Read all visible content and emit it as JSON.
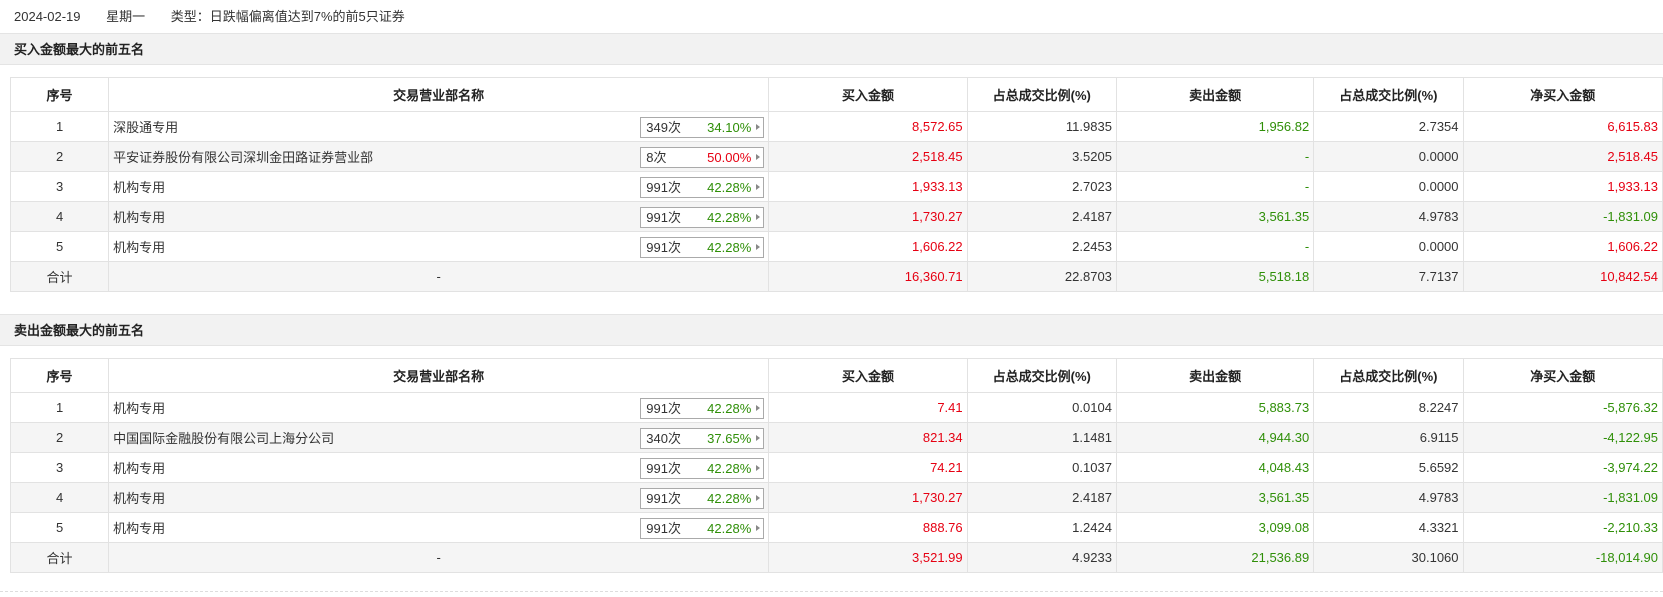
{
  "header": {
    "date": "2024-02-19",
    "weekday": "星期一",
    "type_text": "类型：日跌幅偏离值达到7%的前5只证券"
  },
  "buy_section": {
    "title": "买入金额最大的前五名",
    "columns": [
      "序号",
      "交易营业部名称",
      "买入金额",
      "占总成交比例(%)",
      "卖出金额",
      "占总成交比例(%)",
      "净买入金额"
    ],
    "rows": [
      {
        "idx": "1",
        "name": "深股通专用",
        "count": "349次",
        "rate": "34.10%",
        "rate_color": "green",
        "buy": "8,572.65",
        "buy_pct": "11.9835",
        "sell": "1,956.82",
        "sell_pct": "2.7354",
        "net": "6,615.83",
        "net_color": "red"
      },
      {
        "idx": "2",
        "name": "平安证券股份有限公司深圳金田路证券营业部",
        "count": "8次",
        "rate": "50.00%",
        "rate_color": "red",
        "buy": "2,518.45",
        "buy_pct": "3.5205",
        "sell": "-",
        "sell_pct": "0.0000",
        "net": "2,518.45",
        "net_color": "red"
      },
      {
        "idx": "3",
        "name": "机构专用",
        "count": "991次",
        "rate": "42.28%",
        "rate_color": "green",
        "buy": "1,933.13",
        "buy_pct": "2.7023",
        "sell": "-",
        "sell_pct": "0.0000",
        "net": "1,933.13",
        "net_color": "red"
      },
      {
        "idx": "4",
        "name": "机构专用",
        "count": "991次",
        "rate": "42.28%",
        "rate_color": "green",
        "buy": "1,730.27",
        "buy_pct": "2.4187",
        "sell": "3,561.35",
        "sell_pct": "4.9783",
        "net": "-1,831.09",
        "net_color": "green"
      },
      {
        "idx": "5",
        "name": "机构专用",
        "count": "991次",
        "rate": "42.28%",
        "rate_color": "green",
        "buy": "1,606.22",
        "buy_pct": "2.2453",
        "sell": "-",
        "sell_pct": "0.0000",
        "net": "1,606.22",
        "net_color": "red"
      }
    ],
    "total": {
      "label": "合计",
      "name": "-",
      "buy": "16,360.71",
      "buy_pct": "22.8703",
      "sell": "5,518.18",
      "sell_pct": "7.7137",
      "net": "10,842.54",
      "net_color": "red"
    }
  },
  "sell_section": {
    "title": "卖出金额最大的前五名",
    "columns": [
      "序号",
      "交易营业部名称",
      "买入金额",
      "占总成交比例(%)",
      "卖出金额",
      "占总成交比例(%)",
      "净买入金额"
    ],
    "rows": [
      {
        "idx": "1",
        "name": "机构专用",
        "count": "991次",
        "rate": "42.28%",
        "rate_color": "green",
        "buy": "7.41",
        "buy_pct": "0.0104",
        "sell": "5,883.73",
        "sell_pct": "8.2247",
        "net": "-5,876.32",
        "net_color": "green"
      },
      {
        "idx": "2",
        "name": "中国国际金融股份有限公司上海分公司",
        "count": "340次",
        "rate": "37.65%",
        "rate_color": "green",
        "buy": "821.34",
        "buy_pct": "1.1481",
        "sell": "4,944.30",
        "sell_pct": "6.9115",
        "net": "-4,122.95",
        "net_color": "green"
      },
      {
        "idx": "3",
        "name": "机构专用",
        "count": "991次",
        "rate": "42.28%",
        "rate_color": "green",
        "buy": "74.21",
        "buy_pct": "0.1037",
        "sell": "4,048.43",
        "sell_pct": "5.6592",
        "net": "-3,974.22",
        "net_color": "green"
      },
      {
        "idx": "4",
        "name": "机构专用",
        "count": "991次",
        "rate": "42.28%",
        "rate_color": "green",
        "buy": "1,730.27",
        "buy_pct": "2.4187",
        "sell": "3,561.35",
        "sell_pct": "4.9783",
        "net": "-1,831.09",
        "net_color": "green"
      },
      {
        "idx": "5",
        "name": "机构专用",
        "count": "991次",
        "rate": "42.28%",
        "rate_color": "green",
        "buy": "888.76",
        "buy_pct": "1.2424",
        "sell": "3,099.08",
        "sell_pct": "4.3321",
        "net": "-2,210.33",
        "net_color": "green"
      }
    ],
    "total": {
      "label": "合计",
      "name": "-",
      "buy": "3,521.99",
      "buy_pct": "4.9233",
      "sell": "21,536.89",
      "sell_pct": "30.1060",
      "net": "-18,014.90",
      "net_color": "green"
    }
  },
  "colors": {
    "up": "#e60012",
    "down": "#2f8f08",
    "header_bg": "#f2f2f2",
    "stripe_bg": "#f5f5f5"
  }
}
